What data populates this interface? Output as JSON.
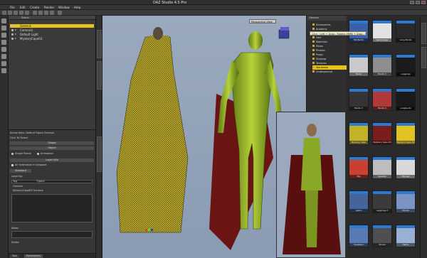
{
  "window": {
    "title": "DAZ Studio 4.5 Pro"
  },
  "menubar": {
    "items": [
      "File",
      "Edit",
      "Create",
      "Render",
      "Window",
      "Help"
    ]
  },
  "scene": {
    "tab": "Scene",
    "rows": [
      {
        "label": "Genesis",
        "selected": true
      },
      {
        "label": "Camera1",
        "selected": false
      },
      {
        "label": "Default Light",
        "selected": false
      },
      {
        "label": "MysteryCapeR3",
        "selected": false
      }
    ]
  },
  "params": {
    "header": "Active Item: Default Figure Genesis",
    "item_label": "Click To Select",
    "shape_band": "Shape",
    "object_band": "Object",
    "radio_single": "Single Frame",
    "radio_multi": "Animation",
    "layers_band": "Layer Info",
    "all_selected": "All Selectable in Viewport",
    "sub_tab": "Standard",
    "layering": "Layering",
    "table_head_a": "Tag",
    "table_head_b": "Figure",
    "row_a": "Genesis",
    "row_b": "MysteryCapeR3 Genesis",
    "notes_label": "Notes",
    "styles_label": "Styles"
  },
  "bottom_tabs": [
    "Tool",
    "Parameters"
  ],
  "viewport": {
    "camera": "Perspective View"
  },
  "tooltip": "Click | Left + Drag : Rotate (MMB + Drag : Pan) (Ctrl + Shift + Drag)",
  "library": {
    "header": "Genesis",
    "folders": [
      {
        "label": "Accessories",
        "selected": false
      },
      {
        "label": "Anatomy",
        "selected": false
      },
      {
        "label": "Figures",
        "selected": false
      },
      {
        "label": "Hair",
        "selected": false
      },
      {
        "label": "Materials",
        "selected": false
      },
      {
        "label": "Poses",
        "selected": false
      },
      {
        "label": "Presets",
        "selected": false
      },
      {
        "label": "Props",
        "selected": false
      },
      {
        "label": "Shaping",
        "selected": false
      },
      {
        "label": "Textures",
        "selected": false
      },
      {
        "label": "Wardrobe",
        "selected": true
      },
      {
        "label": "Underground",
        "selected": false
      }
    ]
  },
  "thumbnails": [
    {
      "label": "M4 Boots",
      "color": "#3b5fa8"
    },
    {
      "label": "Jeans Legs",
      "color": "#e2e2e2"
    },
    {
      "label": "Long Boots",
      "color": "#2a2a2a"
    },
    {
      "label": "Boots",
      "color": "#c9c9c9"
    },
    {
      "label": "Boots 2",
      "color": "#8e8e8e"
    },
    {
      "label": "Leggings",
      "color": "#1b1b1b"
    },
    {
      "label": "Boots 3",
      "color": "#343434"
    },
    {
      "label": "Boots 4",
      "color": "#b03a3a"
    },
    {
      "label": "Longboots",
      "color": "#1a1a1a"
    },
    {
      "label": "Mystery Cape",
      "color": "#c2b329"
    },
    {
      "label": "Mystery Cape R3",
      "color": "#7a1d1d"
    },
    {
      "label": "Mystery Cape R3",
      "color": "#e0c322"
    },
    {
      "label": "Top",
      "color": "#c94033"
    },
    {
      "label": "Sweater",
      "color": "#bdbdbd"
    },
    {
      "label": "Blouse",
      "color": "#d8d8d8"
    },
    {
      "label": "Jeans",
      "color": "#45649a"
    },
    {
      "label": "Leggings 2",
      "color": "#3b3b3b"
    },
    {
      "label": "Shorts",
      "color": "#7b92c4"
    },
    {
      "label": "Sneakers",
      "color": "#5a7ab5"
    },
    {
      "label": "Shoes",
      "color": "#4f4f4f"
    },
    {
      "label": "Pants",
      "color": "#9ab0d3"
    }
  ]
}
